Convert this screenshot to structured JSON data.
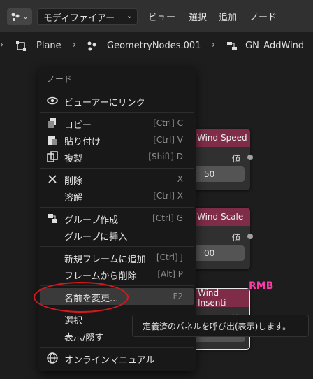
{
  "header": {
    "editor_type_icon": "node-editor-icon",
    "mode_select": "モディファイアー",
    "menus": [
      "ビュー",
      "選択",
      "追加",
      "ノード"
    ]
  },
  "breadcrumb": {
    "object": "Plane",
    "modifier": "GeometryNodes.001",
    "node_group": "GN_AddWind"
  },
  "nodes": [
    {
      "title": "Wind Speed",
      "output": "値",
      "value": "50"
    },
    {
      "title": "Wind Scale",
      "output": "値",
      "value": "00"
    },
    {
      "title": "Wind Insenti",
      "output": "値"
    }
  ],
  "context_menu": {
    "title": "ノード",
    "items": [
      {
        "label": "ビューアーにリンク",
        "shortcut": "",
        "icon": "eye-icon"
      },
      {
        "label": "コピー",
        "shortcut": "[Ctrl] C",
        "icon": "copy-icon"
      },
      {
        "label": "貼り付け",
        "shortcut": "[Ctrl] V",
        "icon": "paste-icon"
      },
      {
        "label": "複製",
        "shortcut": "[Shift] D",
        "icon": "duplicate-icon"
      },
      {
        "label": "削除",
        "shortcut": "X",
        "icon": "x-icon"
      },
      {
        "label": "溶解",
        "shortcut": "[Ctrl] X",
        "icon": ""
      },
      {
        "label": "グループ作成",
        "shortcut": "[Ctrl] G",
        "icon": "node-group-icon"
      },
      {
        "label": "グループに挿入",
        "shortcut": "",
        "icon": ""
      },
      {
        "label": "新規フレームに追加",
        "shortcut": "[Ctrl] J",
        "icon": ""
      },
      {
        "label": "フレームから削除",
        "shortcut": "[Alt] P",
        "icon": ""
      },
      {
        "label": "名前を変更...",
        "shortcut": "F2",
        "icon": ""
      },
      {
        "label": "選択",
        "shortcut": "",
        "icon": ""
      },
      {
        "label": "表示/隠す",
        "shortcut": "",
        "icon": ""
      },
      {
        "label": "オンラインマニュアル",
        "shortcut": "",
        "icon": "globe-icon"
      }
    ]
  },
  "tooltip": "定義済のパネルを呼び出(表示)します。",
  "annotation": "RMB",
  "colors": {
    "node_header": "#7e2c47",
    "annotation": "#ff3aa8",
    "highlight_circle": "#d4181e"
  }
}
